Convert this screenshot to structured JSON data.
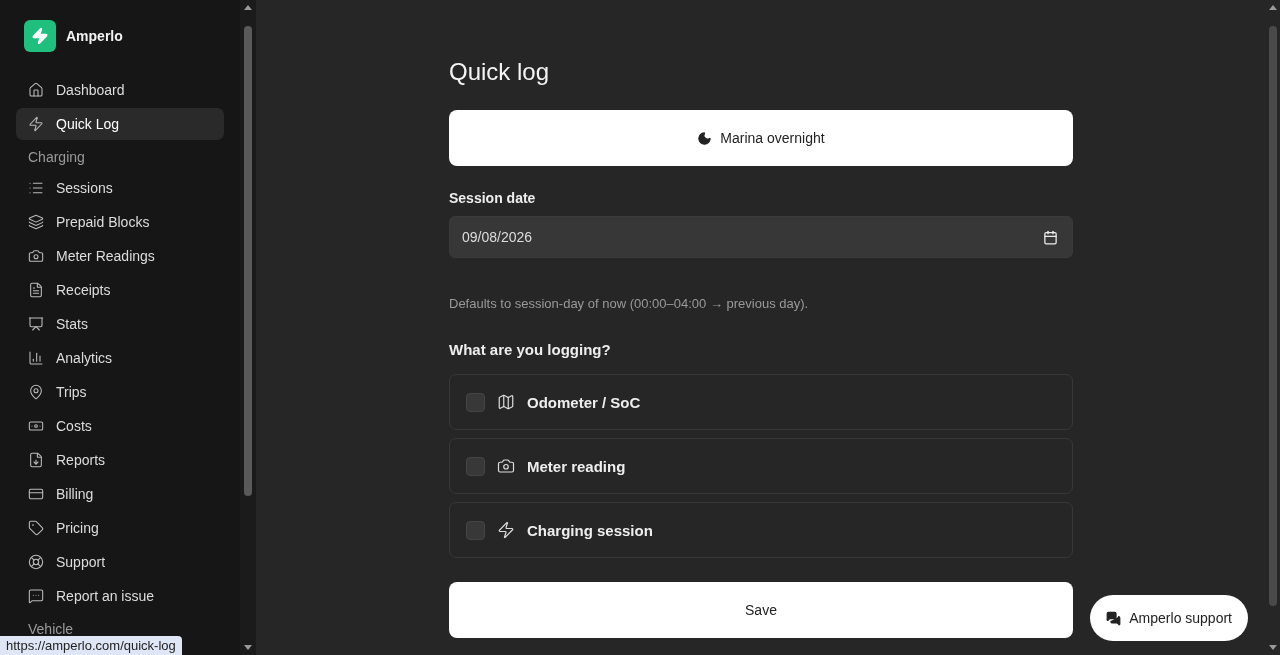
{
  "sidebar": {
    "brand": "Amperlo",
    "nav": [
      {
        "kind": "item",
        "label": "Dashboard",
        "selected": false
      },
      {
        "kind": "item",
        "label": "Quick Log",
        "selected": true
      },
      {
        "kind": "heading",
        "label": "Charging"
      },
      {
        "kind": "item",
        "label": "Sessions",
        "selected": false
      },
      {
        "kind": "item",
        "label": "Prepaid Blocks",
        "selected": false
      },
      {
        "kind": "item",
        "label": "Meter Readings",
        "selected": false
      },
      {
        "kind": "item",
        "label": "Receipts",
        "selected": false
      },
      {
        "kind": "item",
        "label": "Stats",
        "selected": false
      },
      {
        "kind": "item",
        "label": "Analytics",
        "selected": false
      },
      {
        "kind": "item",
        "label": "Trips",
        "selected": false
      },
      {
        "kind": "item",
        "label": "Costs",
        "selected": false
      },
      {
        "kind": "item",
        "label": "Reports",
        "selected": false
      },
      {
        "kind": "item",
        "label": "Billing",
        "selected": false
      },
      {
        "kind": "item",
        "label": "Pricing",
        "selected": false
      },
      {
        "kind": "item",
        "label": "Support",
        "selected": false
      },
      {
        "kind": "item",
        "label": "Report an issue",
        "selected": false
      },
      {
        "kind": "heading",
        "label": "Vehicle"
      }
    ]
  },
  "main": {
    "title": "Quick log",
    "preset_button": "Marina overnight",
    "date_field": {
      "label": "Session date",
      "value": "09/08/2026"
    },
    "hint": "Defaults to session-day of now (00:00–04:00 → previous day).",
    "question": "What are you logging?",
    "options": [
      {
        "label": "Odometer / SoC",
        "checked": false
      },
      {
        "label": "Meter reading",
        "checked": false
      },
      {
        "label": "Charging session",
        "checked": false
      }
    ],
    "save_button": "Save"
  },
  "support_button": "Amperlo support",
  "status_url": "https://amperlo.com/quick-log"
}
